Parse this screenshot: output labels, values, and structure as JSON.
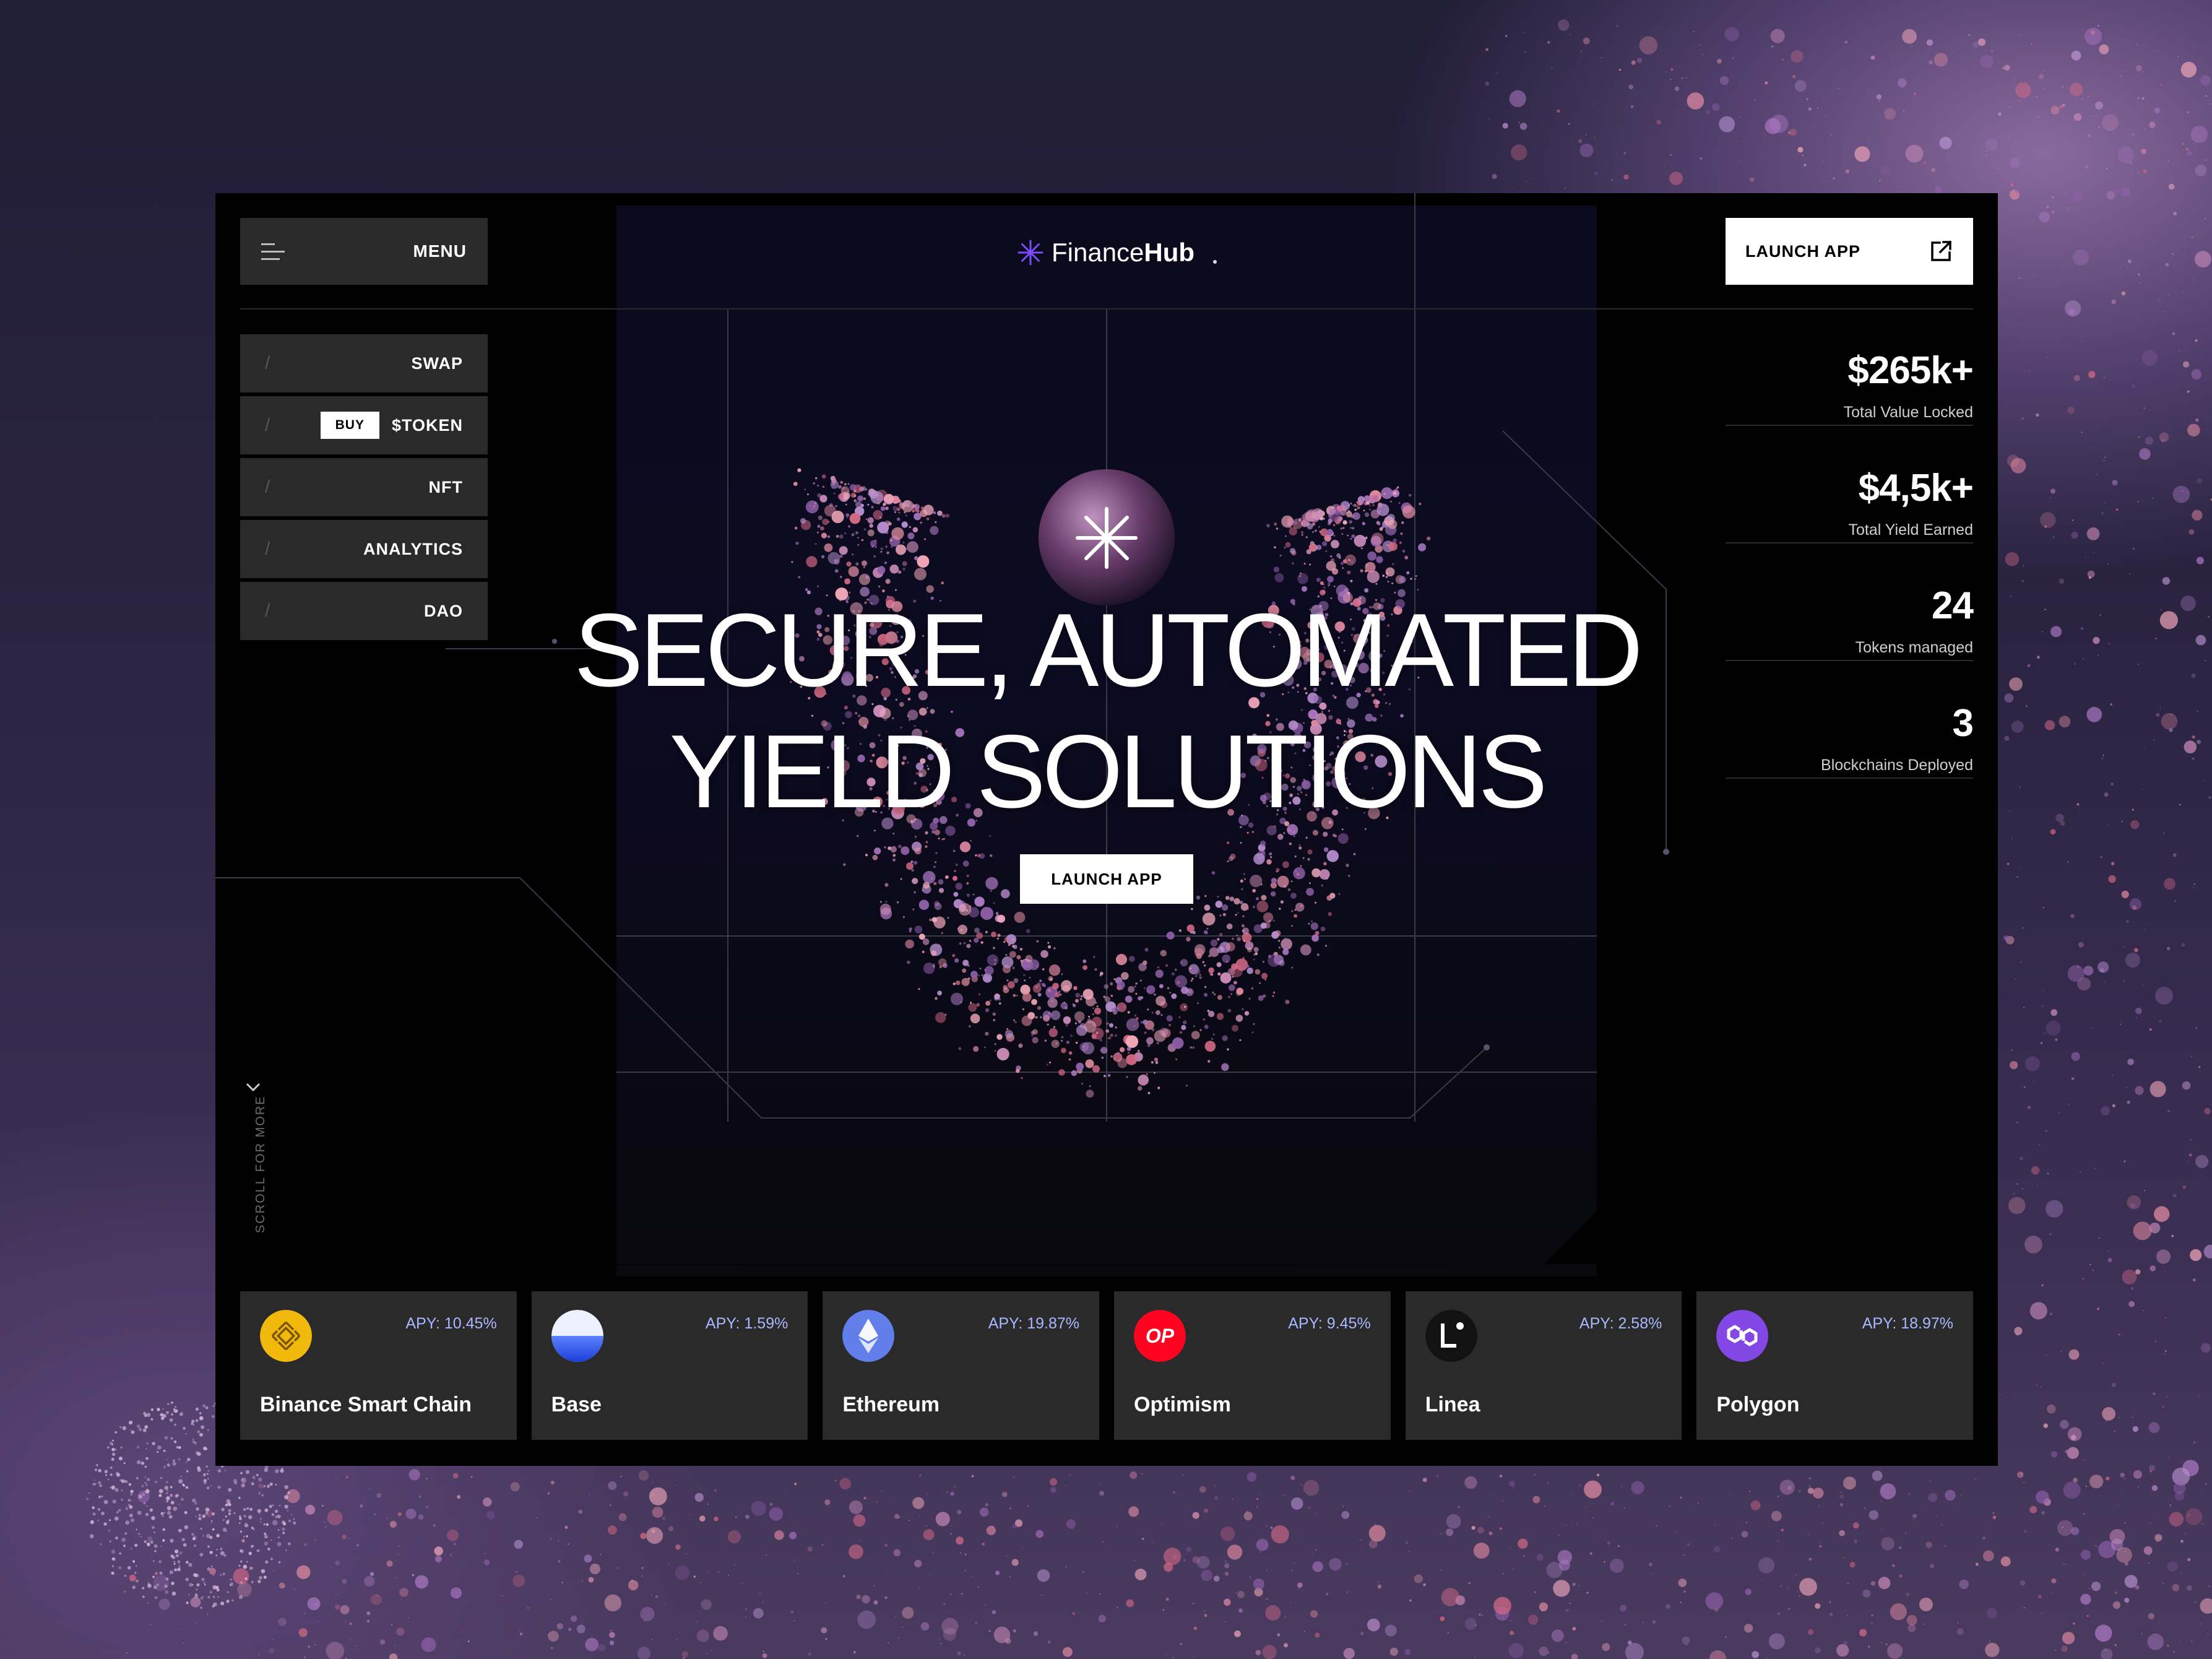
{
  "header": {
    "menu_label": "MENU",
    "logo_part1": "Finance",
    "logo_part2": "Hub",
    "launch_label": "LAUNCH APP"
  },
  "nav": {
    "items": [
      {
        "label": "SWAP"
      },
      {
        "label": "$TOKEN",
        "badge": "BUY"
      },
      {
        "label": "NFT"
      },
      {
        "label": "ANALYTICS"
      },
      {
        "label": "DAO"
      }
    ]
  },
  "stats": [
    {
      "value": "$265k+",
      "label": "Total Value Locked"
    },
    {
      "value": "$4,5k+",
      "label": "Total Yield Earned"
    },
    {
      "value": "24",
      "label": "Tokens managed"
    },
    {
      "value": "3",
      "label": "Blockchains Deployed"
    }
  ],
  "hero": {
    "title_line1": "SECURE, AUTOMATED",
    "title_line2": "YIELD SOLUTIONS",
    "cta_label": "LAUNCH APP"
  },
  "scroll": {
    "label": "SCROLL FOR MORE"
  },
  "chains": [
    {
      "name": "Binance Smart Chain",
      "apy": "APY: 10.45%",
      "icon": "binance-icon",
      "color": "#f0b90b"
    },
    {
      "name": "Base",
      "apy": "APY: 1.59%",
      "icon": "base-icon",
      "color": "#2f5bff"
    },
    {
      "name": "Ethereum",
      "apy": "APY: 19.87%",
      "icon": "ethereum-icon",
      "color": "#627eea"
    },
    {
      "name": "Optimism",
      "apy": "APY: 9.45%",
      "icon": "optimism-icon",
      "color": "#ff0420",
      "icon_text": "OP"
    },
    {
      "name": "Linea",
      "apy": "APY: 2.58%",
      "icon": "linea-icon",
      "color": "#121212"
    },
    {
      "name": "Polygon",
      "apy": "APY: 18.97%",
      "icon": "polygon-icon",
      "color": "#8247e5"
    }
  ],
  "colors": {
    "accent": "#7b4dff",
    "apy_text": "#a9b8ff",
    "panel": "#2a2a2a"
  }
}
